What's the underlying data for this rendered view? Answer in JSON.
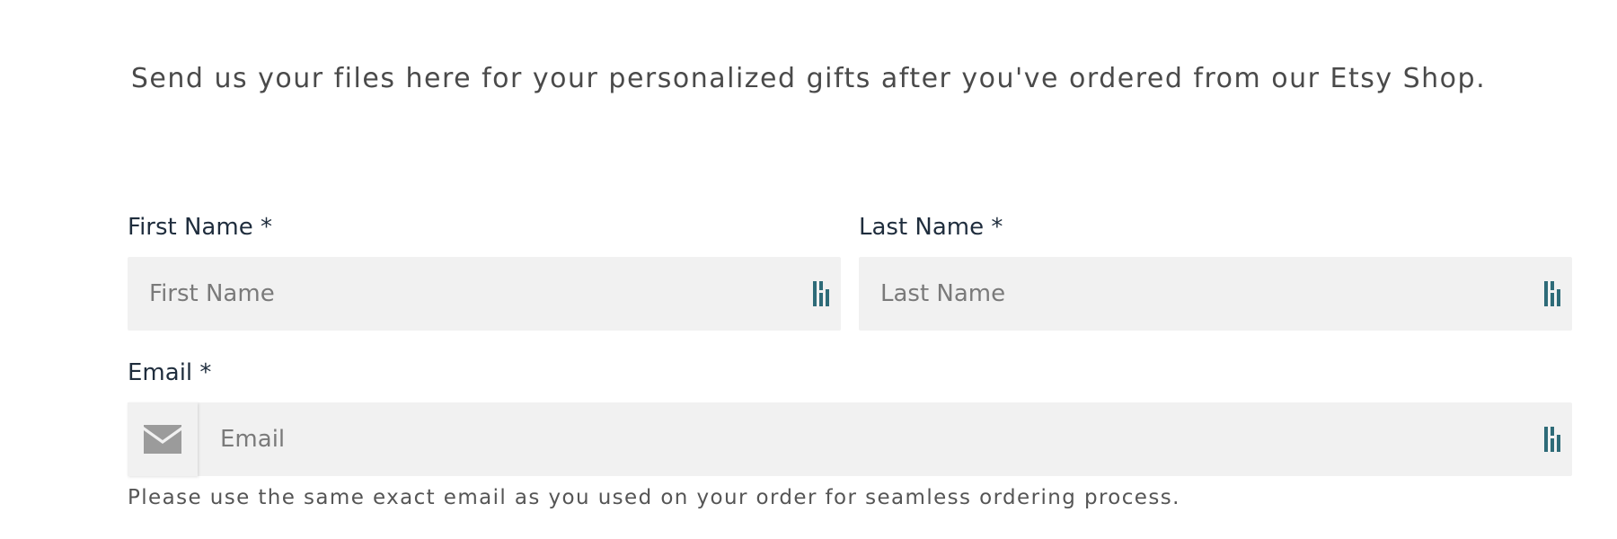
{
  "form": {
    "intro_text": "Send us your files here for your personalized gifts after you've ordered from our Etsy Shop.",
    "first_name": {
      "label": "First Name *",
      "placeholder": "First Name"
    },
    "last_name": {
      "label": "Last Name *",
      "placeholder": "Last Name"
    },
    "email": {
      "label": "Email *",
      "placeholder": "Email",
      "help_text": "Please use the same exact email as you used on your order for seamless ordering process."
    }
  },
  "icons": {
    "autofill": "dashlane-autofill-icon",
    "email": "envelope-icon"
  },
  "colors": {
    "field_background": "#f1f1f1",
    "autofill_icon": "#2e6b78",
    "envelope_icon": "#9b9b9b"
  }
}
